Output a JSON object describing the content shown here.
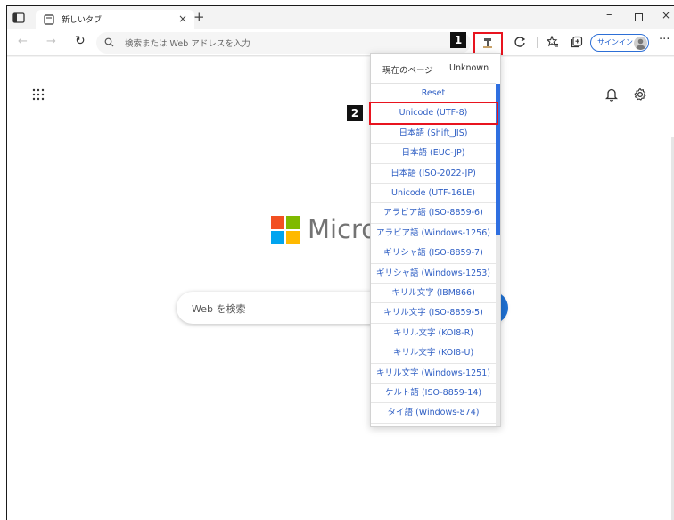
{
  "tab": {
    "title": "新しいタブ",
    "close_glyph": "×",
    "new_tab_glyph": "+"
  },
  "window": {
    "minimize_glyph": "–",
    "close_glyph": "×"
  },
  "toolbar": {
    "back_glyph": "←",
    "forward_glyph": "→",
    "refresh_glyph": "↻",
    "address_placeholder": "検索または Web アドレスを入力",
    "signin_label": "サインイン",
    "more_glyph": "···"
  },
  "page": {
    "logo_text": "Micro",
    "search_placeholder": "Web を検索",
    "logo_colors": [
      "#f25022",
      "#7fba00",
      "#00a4ef",
      "#ffb900"
    ]
  },
  "encoding_menu": {
    "current_page_label": "現在のページ",
    "current_page_value": "Unknown",
    "items": [
      "Reset",
      "Unicode (UTF-8)",
      "日本語 (Shift_JIS)",
      "日本語 (EUC-JP)",
      "日本語 (ISO-2022-JP)",
      "Unicode (UTF-16LE)",
      "アラビア語 (ISO-8859-6)",
      "アラビア語 (Windows-1256)",
      "ギリシャ語 (ISO-8859-7)",
      "ギリシャ語 (Windows-1253)",
      "キリル文字 (IBM866)",
      "キリル文字 (ISO-8859-5)",
      "キリル文字 (KOI8-R)",
      "キリル文字 (KOI8-U)",
      "キリル文字 (Windows-1251)",
      "ケルト語 (ISO-8859-14)",
      "タイ語 (Windows-874)"
    ],
    "highlighted_index": 1
  },
  "callouts": {
    "step1": "1",
    "step2": "2"
  },
  "colors": {
    "accent": "#2f5fc4",
    "callout_border": "#e8141f"
  }
}
